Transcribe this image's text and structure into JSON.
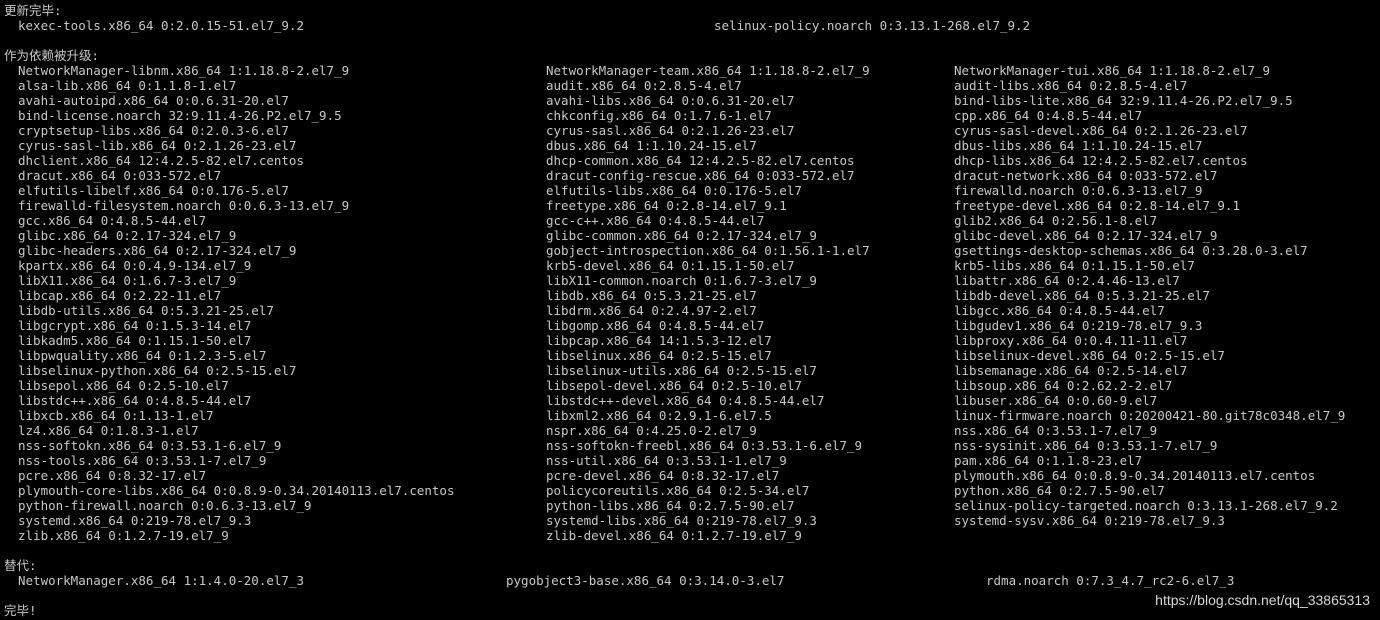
{
  "headers": {
    "updated": "更新完毕:",
    "dependency": "作为依赖被升级:",
    "replaced": "替代:",
    "done": "完毕!"
  },
  "updated_items": [
    "kexec-tools.x86_64 0:2.0.15-51.el7_9.2",
    "selinux-policy.noarch 0:3.13.1-268.el7_9.2"
  ],
  "dependency_rows": [
    [
      "NetworkManager-libnm.x86_64 1:1.18.8-2.el7_9",
      "NetworkManager-team.x86_64 1:1.18.8-2.el7_9",
      "NetworkManager-tui.x86_64 1:1.18.8-2.el7_9"
    ],
    [
      "alsa-lib.x86_64 0:1.1.8-1.el7",
      "audit.x86_64 0:2.8.5-4.el7",
      "audit-libs.x86_64 0:2.8.5-4.el7"
    ],
    [
      "avahi-autoipd.x86_64 0:0.6.31-20.el7",
      "avahi-libs.x86_64 0:0.6.31-20.el7",
      "bind-libs-lite.x86_64 32:9.11.4-26.P2.el7_9.5"
    ],
    [
      "bind-license.noarch 32:9.11.4-26.P2.el7_9.5",
      "chkconfig.x86_64 0:1.7.6-1.el7",
      "cpp.x86_64 0:4.8.5-44.el7"
    ],
    [
      "cryptsetup-libs.x86_64 0:2.0.3-6.el7",
      "cyrus-sasl.x86_64 0:2.1.26-23.el7",
      "cyrus-sasl-devel.x86_64 0:2.1.26-23.el7"
    ],
    [
      "cyrus-sasl-lib.x86_64 0:2.1.26-23.el7",
      "dbus.x86_64 1:1.10.24-15.el7",
      "dbus-libs.x86_64 1:1.10.24-15.el7"
    ],
    [
      "dhclient.x86_64 12:4.2.5-82.el7.centos",
      "dhcp-common.x86_64 12:4.2.5-82.el7.centos",
      "dhcp-libs.x86_64 12:4.2.5-82.el7.centos"
    ],
    [
      "dracut.x86_64 0:033-572.el7",
      "dracut-config-rescue.x86_64 0:033-572.el7",
      "dracut-network.x86_64 0:033-572.el7"
    ],
    [
      "elfutils-libelf.x86_64 0:0.176-5.el7",
      "elfutils-libs.x86_64 0:0.176-5.el7",
      "firewalld.noarch 0:0.6.3-13.el7_9"
    ],
    [
      "firewalld-filesystem.noarch 0:0.6.3-13.el7_9",
      "freetype.x86_64 0:2.8-14.el7_9.1",
      "freetype-devel.x86_64 0:2.8-14.el7_9.1"
    ],
    [
      "gcc.x86_64 0:4.8.5-44.el7",
      "gcc-c++.x86_64 0:4.8.5-44.el7",
      "glib2.x86_64 0:2.56.1-8.el7"
    ],
    [
      "glibc.x86_64 0:2.17-324.el7_9",
      "glibc-common.x86_64 0:2.17-324.el7_9",
      "glibc-devel.x86_64 0:2.17-324.el7_9"
    ],
    [
      "glibc-headers.x86_64 0:2.17-324.el7_9",
      "gobject-introspection.x86_64 0:1.56.1-1.el7",
      "gsettings-desktop-schemas.x86_64 0:3.28.0-3.el7"
    ],
    [
      "kpartx.x86_64 0:0.4.9-134.el7_9",
      "krb5-devel.x86_64 0:1.15.1-50.el7",
      "krb5-libs.x86_64 0:1.15.1-50.el7"
    ],
    [
      "libX11.x86_64 0:1.6.7-3.el7_9",
      "libX11-common.noarch 0:1.6.7-3.el7_9",
      "libattr.x86_64 0:2.4.46-13.el7"
    ],
    [
      "libcap.x86_64 0:2.22-11.el7",
      "libdb.x86_64 0:5.3.21-25.el7",
      "libdb-devel.x86_64 0:5.3.21-25.el7"
    ],
    [
      "libdb-utils.x86_64 0:5.3.21-25.el7",
      "libdrm.x86_64 0:2.4.97-2.el7",
      "libgcc.x86_64 0:4.8.5-44.el7"
    ],
    [
      "libgcrypt.x86_64 0:1.5.3-14.el7",
      "libgomp.x86_64 0:4.8.5-44.el7",
      "libgudev1.x86_64 0:219-78.el7_9.3"
    ],
    [
      "libkadm5.x86_64 0:1.15.1-50.el7",
      "libpcap.x86_64 14:1.5.3-12.el7",
      "libproxy.x86_64 0:0.4.11-11.el7"
    ],
    [
      "libpwquality.x86_64 0:1.2.3-5.el7",
      "libselinux.x86_64 0:2.5-15.el7",
      "libselinux-devel.x86_64 0:2.5-15.el7"
    ],
    [
      "libselinux-python.x86_64 0:2.5-15.el7",
      "libselinux-utils.x86_64 0:2.5-15.el7",
      "libsemanage.x86_64 0:2.5-14.el7"
    ],
    [
      "libsepol.x86_64 0:2.5-10.el7",
      "libsepol-devel.x86_64 0:2.5-10.el7",
      "libsoup.x86_64 0:2.62.2-2.el7"
    ],
    [
      "libstdc++.x86_64 0:4.8.5-44.el7",
      "libstdc++-devel.x86_64 0:4.8.5-44.el7",
      "libuser.x86_64 0:0.60-9.el7"
    ],
    [
      "libxcb.x86_64 0:1.13-1.el7",
      "libxml2.x86_64 0:2.9.1-6.el7.5",
      "linux-firmware.noarch 0:20200421-80.git78c0348.el7_9"
    ],
    [
      "lz4.x86_64 0:1.8.3-1.el7",
      "nspr.x86_64 0:4.25.0-2.el7_9",
      "nss.x86_64 0:3.53.1-7.el7_9"
    ],
    [
      "nss-softokn.x86_64 0:3.53.1-6.el7_9",
      "nss-softokn-freebl.x86_64 0:3.53.1-6.el7_9",
      "nss-sysinit.x86_64 0:3.53.1-7.el7_9"
    ],
    [
      "nss-tools.x86_64 0:3.53.1-7.el7_9",
      "nss-util.x86_64 0:3.53.1-1.el7_9",
      "pam.x86_64 0:1.1.8-23.el7"
    ],
    [
      "pcre.x86_64 0:8.32-17.el7",
      "pcre-devel.x86_64 0:8.32-17.el7",
      "plymouth.x86_64 0:0.8.9-0.34.20140113.el7.centos"
    ],
    [
      "plymouth-core-libs.x86_64 0:0.8.9-0.34.20140113.el7.centos",
      "policycoreutils.x86_64 0:2.5-34.el7",
      "python.x86_64 0:2.7.5-90.el7"
    ],
    [
      "python-firewall.noarch 0:0.6.3-13.el7_9",
      "python-libs.x86_64 0:2.7.5-90.el7",
      "selinux-policy-targeted.noarch 0:3.13.1-268.el7_9.2"
    ],
    [
      "systemd.x86_64 0:219-78.el7_9.3",
      "systemd-libs.x86_64 0:219-78.el7_9.3",
      "systemd-sysv.x86_64 0:219-78.el7_9.3"
    ],
    [
      "zlib.x86_64 0:1.2.7-19.el7_9",
      "zlib-devel.x86_64 0:1.2.7-19.el7_9",
      ""
    ]
  ],
  "replaced_items": [
    "NetworkManager.x86_64 1:1.4.0-20.el7_3",
    "pygobject3-base.x86_64 0:3.14.0-3.el7",
    "rdma.noarch 0:7.3_4.7_rc2-6.el7_3"
  ],
  "watermark": "https://blog.csdn.net/qq_33865313"
}
